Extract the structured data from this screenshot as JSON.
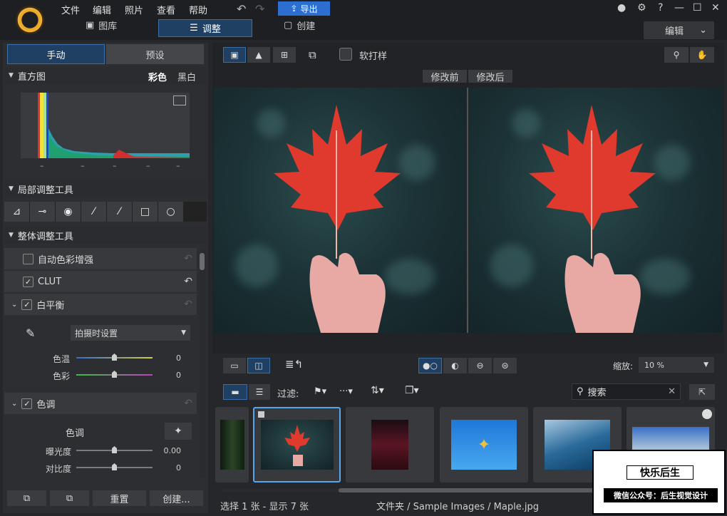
{
  "menu": [
    "文件",
    "编辑",
    "照片",
    "查看",
    "帮助"
  ],
  "export_label": "导出",
  "top_tabs": {
    "library": "图库",
    "adjust": "调整",
    "create": "创建"
  },
  "mode_select": "编辑",
  "window_controls": {
    "help": "?",
    "minimize": "—",
    "maximize": "☐",
    "close": "✕"
  },
  "left_tabs": {
    "manual": "手动",
    "presets": "预设"
  },
  "histogram": {
    "title": "直方图",
    "color": "彩色",
    "bw": "黑白",
    "marks": [
      "–",
      "–",
      "–",
      "–",
      "–"
    ]
  },
  "local_tools": {
    "title": "局部调整工具"
  },
  "global_tools": {
    "title": "整体调整工具"
  },
  "auto_color": {
    "label": "自动色彩增强"
  },
  "clut": {
    "label": "CLUT"
  },
  "white_balance": {
    "label": "白平衡",
    "preset": "拍摄时设置",
    "temp_label": "色温",
    "temp_value": "0",
    "tint_label": "色彩",
    "tint_value": "0"
  },
  "tone": {
    "label": "色调",
    "sub_label": "色调",
    "exposure_label": "曝光度",
    "exposure_value": "0.00",
    "contrast_label": "对比度",
    "contrast_value": "0"
  },
  "bottom_buttons": {
    "reset": "重置",
    "create": "创建..."
  },
  "viewer": {
    "soft_proof": "软打样",
    "before": "修改前",
    "after": "修改后"
  },
  "zoom": {
    "label": "缩放:",
    "value": "10 %"
  },
  "filter": {
    "label": "过滤:"
  },
  "search": {
    "label": "搜索"
  },
  "status": {
    "selection": "选择 1 张 - 显示 7 张",
    "path": "文件夹 / Sample Images / Maple.jpg"
  },
  "watermark": {
    "line1": "快乐后生",
    "line2": "微信公众号：后生视觉设计"
  },
  "colors": {
    "accent": "#2d6fd1",
    "selected_border": "#5aa6ec",
    "leaf": "#e03a2e"
  }
}
